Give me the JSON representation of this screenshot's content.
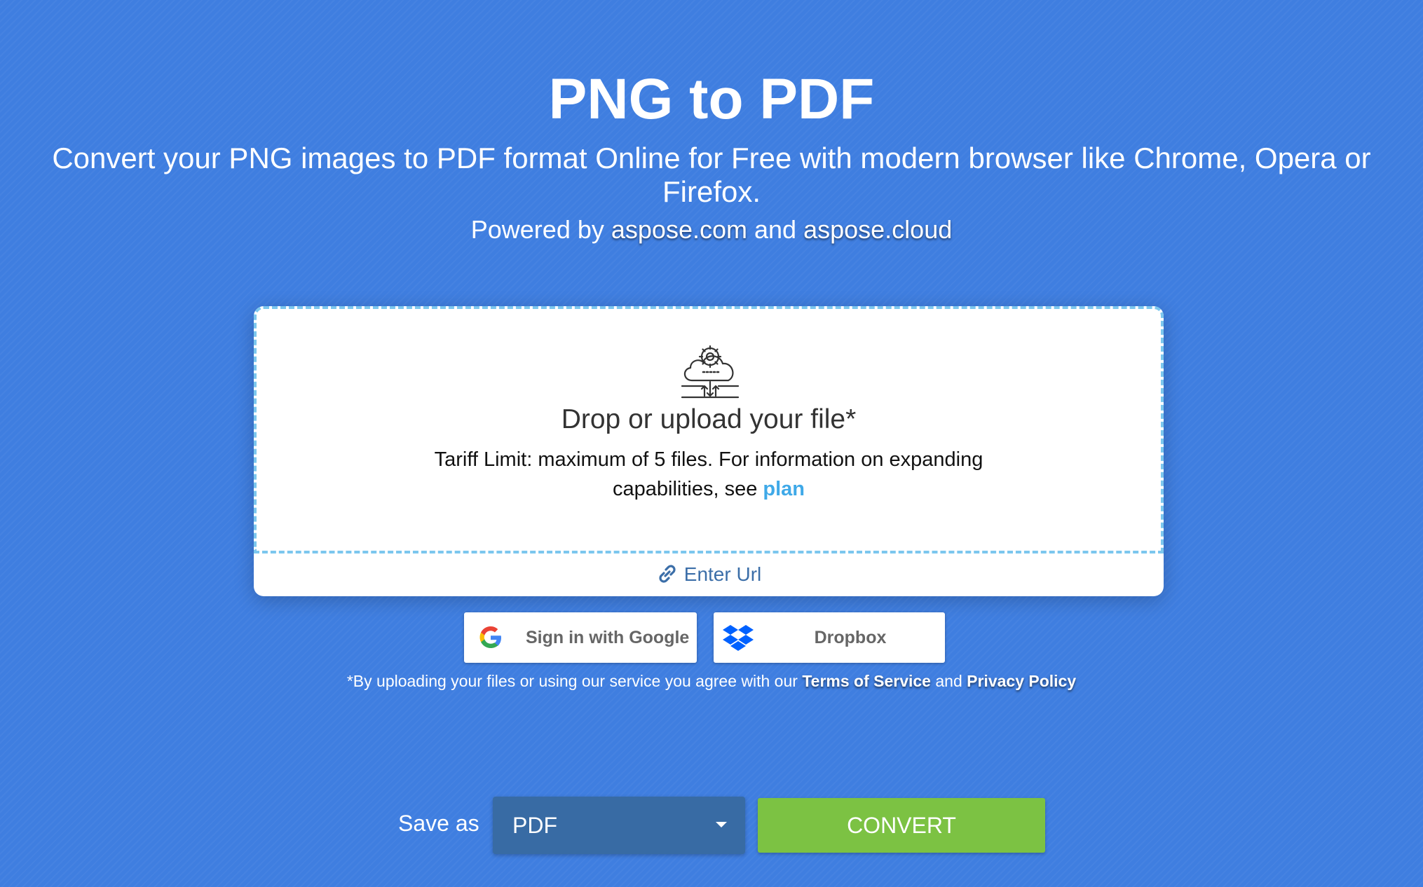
{
  "header": {
    "title": "PNG to PDF",
    "subtitle": "Convert your PNG images to PDF format Online for Free with modern browser like Chrome, Opera or Firefox.",
    "powered_prefix": "Powered by",
    "powered_link1": "aspose.com",
    "powered_and": "and",
    "powered_link2": "aspose.cloud"
  },
  "upload": {
    "icon": "cloud-gear-icon",
    "drop_title": "Drop or upload your file*",
    "tariff_text": "Tariff Limit: maximum of 5 files. For information on expanding capabilities, see",
    "plan_link": "plan",
    "enter_url": "Enter Url"
  },
  "cloud_buttons": {
    "google_label": "Sign in with Google",
    "dropbox_label": "Dropbox"
  },
  "terms": {
    "prefix": "*By uploading your files or using our service you agree with our",
    "tos": "Terms of Service",
    "and": "and",
    "privacy": "Privacy Policy"
  },
  "convert_bar": {
    "save_as_label": "Save as",
    "selected_format": "PDF",
    "convert_label": "CONVERT"
  },
  "colors": {
    "background": "#3f7ee0",
    "dashed_border": "#7cc7ee",
    "plan_link": "#3fa9e8",
    "select_bg": "#386ba4",
    "convert_bg": "#7cc243"
  }
}
